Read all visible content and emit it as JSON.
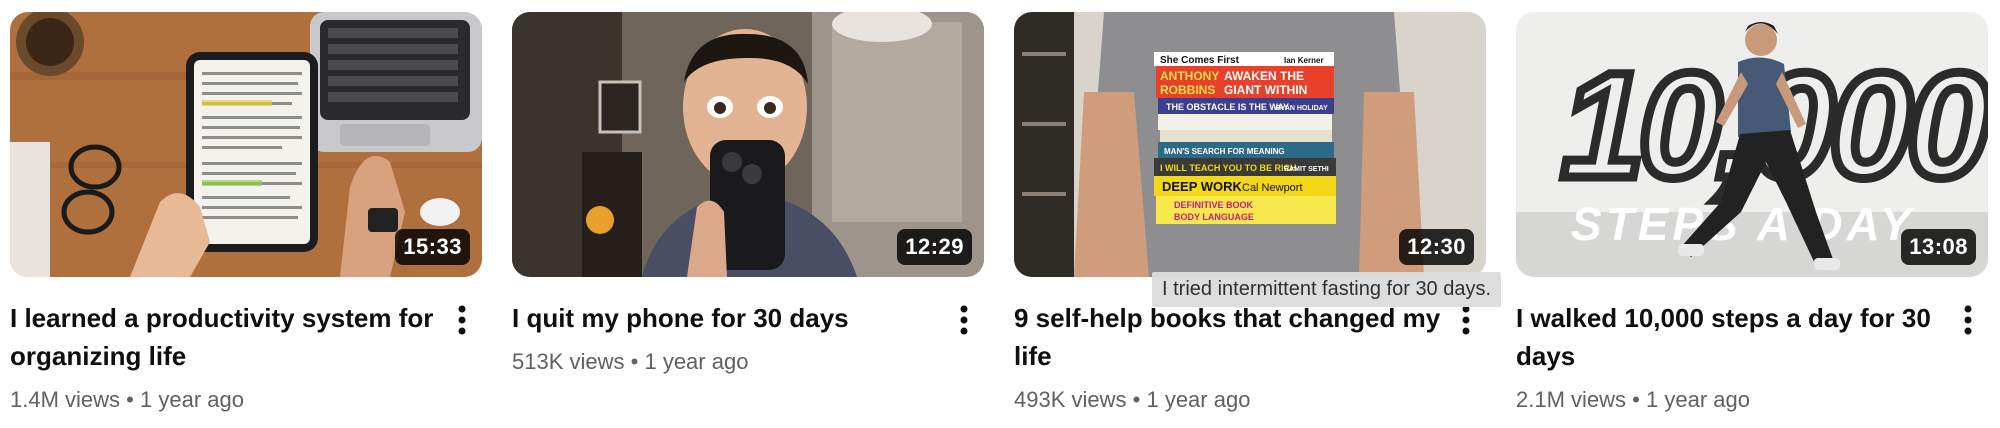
{
  "videos": [
    {
      "title": "I learned a productivity system for organizing life",
      "duration": "15:33",
      "views": "1.4M views",
      "age": "1 year ago"
    },
    {
      "title": "I quit my phone for 30 days",
      "duration": "12:29",
      "views": "513K views",
      "age": "1 year ago"
    },
    {
      "title": "9 self-help books that changed my life",
      "duration": "12:30",
      "views": "493K views",
      "age": "1 year ago"
    },
    {
      "title": "I walked 10,000 steps a day for 30 days",
      "duration": "13:08",
      "views": "2.1M views",
      "age": "1 year ago"
    }
  ],
  "separator": "•",
  "tooltip": "I tried intermittent fasting for 30 days.",
  "thumbnail_text": {
    "books": [
      "She Comes First",
      "Ian Kerner",
      "ANTHONY",
      "ROBBINS",
      "AWAKEN THE",
      "GIANT WITHIN",
      "THE OBSTACLE IS THE WAY",
      "RYAN HOLIDAY",
      "MAN'S SEARCH FOR MEANING",
      "I WILL TEACH YOU TO BE RICH",
      "RAMIT SETHI",
      "DEEP WORK",
      "Cal Newport",
      "DEFINITIVE BOOK",
      "BODY LANGUAGE"
    ],
    "steps_number": "10,000",
    "steps_caption": "STEPS A DAY"
  },
  "icons": {
    "more": "more-vertical-icon"
  }
}
